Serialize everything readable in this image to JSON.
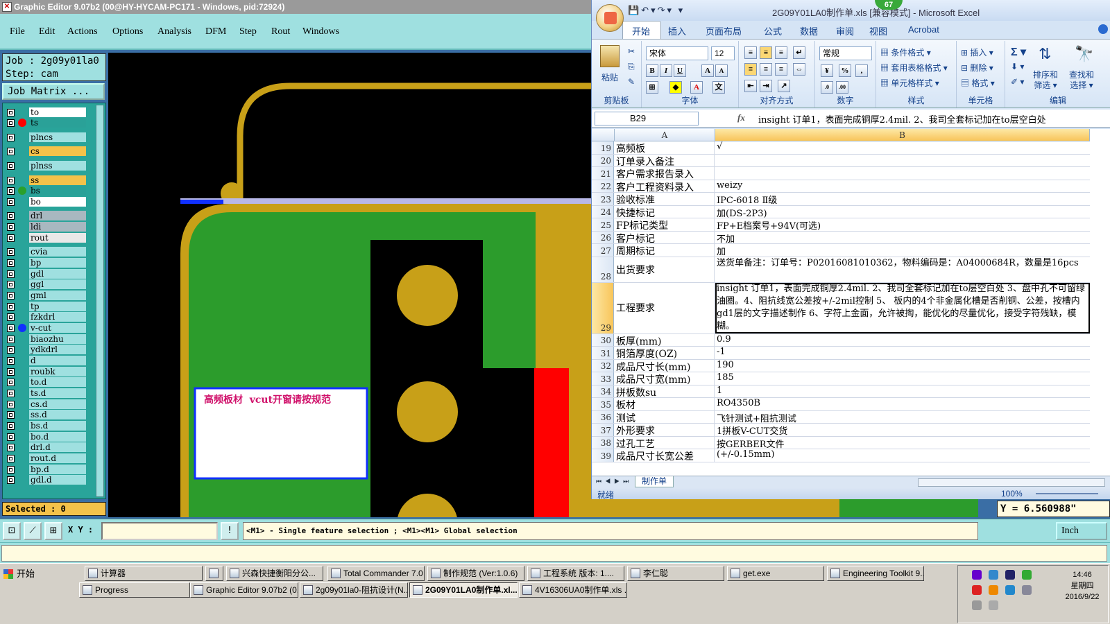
{
  "editor": {
    "title": "Graphic Editor 9.07b2 (00@HY-HYCAM-PC171 - Windows, pid:72924)",
    "menu": [
      "File",
      "Edit",
      "Actions",
      "Options",
      "Analysis",
      "DFM",
      "Step",
      "Rout",
      "Windows"
    ],
    "job_line": "Job : 2g09y01la0",
    "step_line": "Step: cam",
    "job_matrix_label": "Job Matrix ...",
    "layers": [
      {
        "name": "to",
        "color": "#ffffff",
        "dot": ""
      },
      {
        "name": "ts",
        "color": "#2aa198",
        "dot": "#ff0000"
      },
      {
        "name": "plncs",
        "color": "#9fe0e0",
        "dot": ""
      },
      {
        "name": "cs",
        "color": "#f4c24a",
        "dot": ""
      },
      {
        "name": "plnss",
        "color": "#9fe0e0",
        "dot": ""
      },
      {
        "name": "ss",
        "color": "#f4c24a",
        "dot": ""
      },
      {
        "name": "bs",
        "color": "#2aa198",
        "dot": "#2aa02a"
      },
      {
        "name": "bo",
        "color": "#ffffff",
        "dot": ""
      },
      {
        "name": "drl",
        "color": "#a8b8c0",
        "dot": ""
      },
      {
        "name": "ldi",
        "color": "#a8b8c0",
        "dot": ""
      },
      {
        "name": "rout",
        "color": "#e8e8e8",
        "dot": ""
      },
      {
        "name": "cvia",
        "color": "#9fe0e0",
        "dot": ""
      },
      {
        "name": "bp",
        "color": "#9fe0e0",
        "dot": ""
      },
      {
        "name": "gdl",
        "color": "#9fe0e0",
        "dot": ""
      },
      {
        "name": "ggl",
        "color": "#9fe0e0",
        "dot": ""
      },
      {
        "name": "gml",
        "color": "#9fe0e0",
        "dot": ""
      },
      {
        "name": "tp",
        "color": "#9fe0e0",
        "dot": ""
      },
      {
        "name": "fzkdrl",
        "color": "#9fe0e0",
        "dot": ""
      },
      {
        "name": "v-cut",
        "color": "#9fe0e0",
        "dot": "#1030ff"
      },
      {
        "name": "biaozhu",
        "color": "#9fe0e0",
        "dot": ""
      },
      {
        "name": "ydkdrl",
        "color": "#9fe0e0",
        "dot": ""
      },
      {
        "name": "d",
        "color": "#9fe0e0",
        "dot": ""
      },
      {
        "name": "roubk",
        "color": "#9fe0e0",
        "dot": ""
      },
      {
        "name": "to.d",
        "color": "#9fe0e0",
        "dot": ""
      },
      {
        "name": "ts.d",
        "color": "#9fe0e0",
        "dot": ""
      },
      {
        "name": "cs.d",
        "color": "#9fe0e0",
        "dot": ""
      },
      {
        "name": "ss.d",
        "color": "#9fe0e0",
        "dot": ""
      },
      {
        "name": "bs.d",
        "color": "#9fe0e0",
        "dot": ""
      },
      {
        "name": "bo.d",
        "color": "#9fe0e0",
        "dot": ""
      },
      {
        "name": "drl.d",
        "color": "#9fe0e0",
        "dot": ""
      },
      {
        "name": "rout.d",
        "color": "#9fe0e0",
        "dot": ""
      },
      {
        "name": "bp.d",
        "color": "#9fe0e0",
        "dot": ""
      },
      {
        "name": "gdl.d",
        "color": "#9fe0e0",
        "dot": ""
      }
    ],
    "selected_label": "Selected : 0",
    "canvas_note": "高频板材  vcut开窗请按规范",
    "xy_label": "X Y :",
    "xy_value": "",
    "hint": "<M1> - Single feature selection ; <M1><M1> Global selection",
    "y_coord": "Y = 6.560988\"",
    "units": "Inch",
    "colors": {
      "copper": "#c8a018",
      "mask": "#2c9c2c",
      "red": "#ff0000",
      "vcut": "#1030ff"
    }
  },
  "excel": {
    "title_file": "2G09Y01LA0制作单.xls",
    "title_mode": "[兼容模式]",
    "title_app": "- Microsoft Excel",
    "badge": "67",
    "tabs": [
      "开始",
      "插入",
      "页面布局",
      "公式",
      "数据",
      "审阅",
      "视图",
      "Acrobat"
    ],
    "ribbon": {
      "clipboard": {
        "paste": "粘贴",
        "label": "剪贴板"
      },
      "font": {
        "name": "宋体",
        "size": "12",
        "label": "字体"
      },
      "align": {
        "label": "对齐方式"
      },
      "number": {
        "format": "常规",
        "label": "数字"
      },
      "styles": {
        "cond": "条件格式",
        "table": "套用表格格式",
        "cell": "单元格样式",
        "label": "样式"
      },
      "cells": {
        "insert": "插入",
        "delete": "删除",
        "format": "格式",
        "label": "单元格"
      },
      "edit": {
        "sort": "排序和",
        "sort2": "筛选",
        "find": "查找和",
        "find2": "选择",
        "label": "编辑"
      }
    },
    "name_box": "B29",
    "fx": "fx",
    "formula": "insight 订单1，表面完成铜厚2.4mil.   2、我司全套标记加在to层空白处",
    "col_a": "A",
    "col_b": "B",
    "rows": [
      {
        "n": "19",
        "a": "高频板",
        "b": "√"
      },
      {
        "n": "20",
        "a": "订单录入备注",
        "b": ""
      },
      {
        "n": "21",
        "a": "客户需求报告录入",
        "b": ""
      },
      {
        "n": "22",
        "a": "客户工程资料录入",
        "b": "weizy"
      },
      {
        "n": "23",
        "a": "验收标准",
        "b": "IPC-6018 Ⅱ级"
      },
      {
        "n": "24",
        "a": "快捷标记",
        "b": "加(DS-2P3)"
      },
      {
        "n": "25",
        "a": "FP标记类型",
        "b": "FP+E档案号+94V(可选)"
      },
      {
        "n": "26",
        "a": "客户标记",
        "b": "不加"
      },
      {
        "n": "27",
        "a": "周期标记",
        "b": "加"
      },
      {
        "n": "28",
        "a": "出货要求",
        "b": "送货单备注：订单号：P02016081010362，物料编码是：A04000684R，数量是16pcs"
      },
      {
        "n": "29",
        "a": "工程要求",
        "b": "insight 订单1，表面完成铜厚2.4mil.   2、我司全套标记加在to层空白处 3、盘中孔不可留绿油圈。4、阻抗线宽公差按+/-2mil控制   5、  板内的4个非金属化槽是否削铜、公差，按槽内gd1层的文字描述制作   6、字符上金面，允许被掏，能优化的尽量优化，接受字符残缺，模糊。"
      },
      {
        "n": "30",
        "a": "板厚(mm)",
        "b": "0.9"
      },
      {
        "n": "31",
        "a": "铜箔厚度(OZ)",
        "b": "-1"
      },
      {
        "n": "32",
        "a": "成品尺寸长(mm)",
        "b": "190"
      },
      {
        "n": "33",
        "a": "成品尺寸宽(mm)",
        "b": "185"
      },
      {
        "n": "34",
        "a": "拼板数su",
        "b": "1"
      },
      {
        "n": "35",
        "a": "板材",
        "b": "RO4350B"
      },
      {
        "n": "36",
        "a": "测试",
        "b": "飞针测试+阻抗测试"
      },
      {
        "n": "37",
        "a": "外形要求",
        "b": "1拼板V-CUT交货"
      },
      {
        "n": "38",
        "a": "过孔工艺",
        "b": "按GERBER文件"
      },
      {
        "n": "39",
        "a": "成品尺寸长宽公差",
        "b": "(+/-0.15mm)"
      }
    ],
    "sheet_tab": "制作单",
    "status_ready": "就绪",
    "zoom": "100%"
  },
  "taskbar": {
    "start": "开始",
    "row1": [
      "计算器",
      "",
      "兴森快捷衡阳分公...",
      "Total Commander 7.0 ...",
      "制作规范 (Ver:1.0.6)",
      "工程系统  版本: 1....",
      "李仁聪",
      "get.exe",
      "Engineering Toolkit 9...."
    ],
    "row2": [
      "Progress",
      "Graphic Editor 9.07b2 (0...",
      "2g09y01la0-阻抗设计(N...",
      "2G09Y01LA0制作单.xl...",
      "4V16306UA0制作单.xls ..."
    ],
    "time": "14:46",
    "weekday": "星期四",
    "date": "2016/9/22"
  }
}
